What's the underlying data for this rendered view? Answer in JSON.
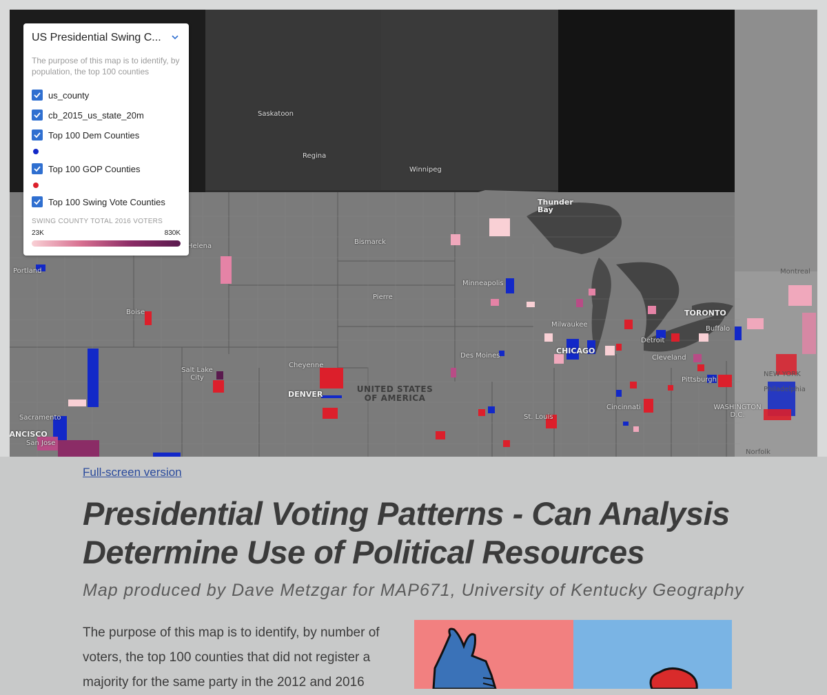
{
  "legend": {
    "title": "US Presidential Swing C...",
    "description": "The purpose of this map is to identify, by population, the top 100 counties",
    "layers": [
      {
        "label": "us_county",
        "checked": true
      },
      {
        "label": "cb_2015_us_state_20m",
        "checked": true
      },
      {
        "label": "Top 100 Dem Counties",
        "checked": true,
        "swatch": "#1228c8"
      },
      {
        "label": "Top 100 GOP Counties",
        "checked": true,
        "swatch": "#dc1f2b"
      },
      {
        "label": "Top 100 Swing Vote Counties",
        "checked": true
      }
    ],
    "ramp": {
      "title": "SWING COUNTY TOTAL 2016 VOTERS",
      "min": "23K",
      "max": "830K"
    }
  },
  "map_labels": {
    "cities": [
      "Saskatoon",
      "Regina",
      "Winnipeg",
      "Thunder Bay",
      "Helena",
      "Portland",
      "Boise",
      "Bismarck",
      "Pierre",
      "Minneapolis",
      "Milwaukee",
      "Detroit",
      "TORONTO",
      "Buffalo",
      "Montreal",
      "CHICAGO",
      "Cleveland",
      "Pittsburgh",
      "NEW YORK",
      "Philadelphia",
      "Des Moines",
      "Cheyenne",
      "Salt Lake City",
      "DENVER",
      "St. Louis",
      "Cincinnati",
      "WASHINGTON D.C.",
      "Norfolk",
      "Sacramento",
      "SAN FRANCISCO",
      "San Jose"
    ],
    "country": "UNITED STATES OF AMERICA"
  },
  "colors": {
    "dem": "#1228c8",
    "gop": "#dc1f2b",
    "swing_light": "#f9d0d5",
    "swing_dark": "#5a1a4e",
    "link": "#2a4a9c"
  },
  "page": {
    "fullscreen_link": "Full-screen version",
    "title": "Presidential Voting Patterns - Can Analysis Determine Use of Political Resources",
    "subtitle": "Map produced by Dave Metzgar for MAP671, University of Kentucky Geography",
    "body": "The purpose of this map is to identify, by number of voters, the top 100 counties that did not register a majority for the same party in the 2012 and 2016"
  },
  "illustration": {
    "left_color": "#f28080",
    "right_color": "#7ab4e4"
  }
}
